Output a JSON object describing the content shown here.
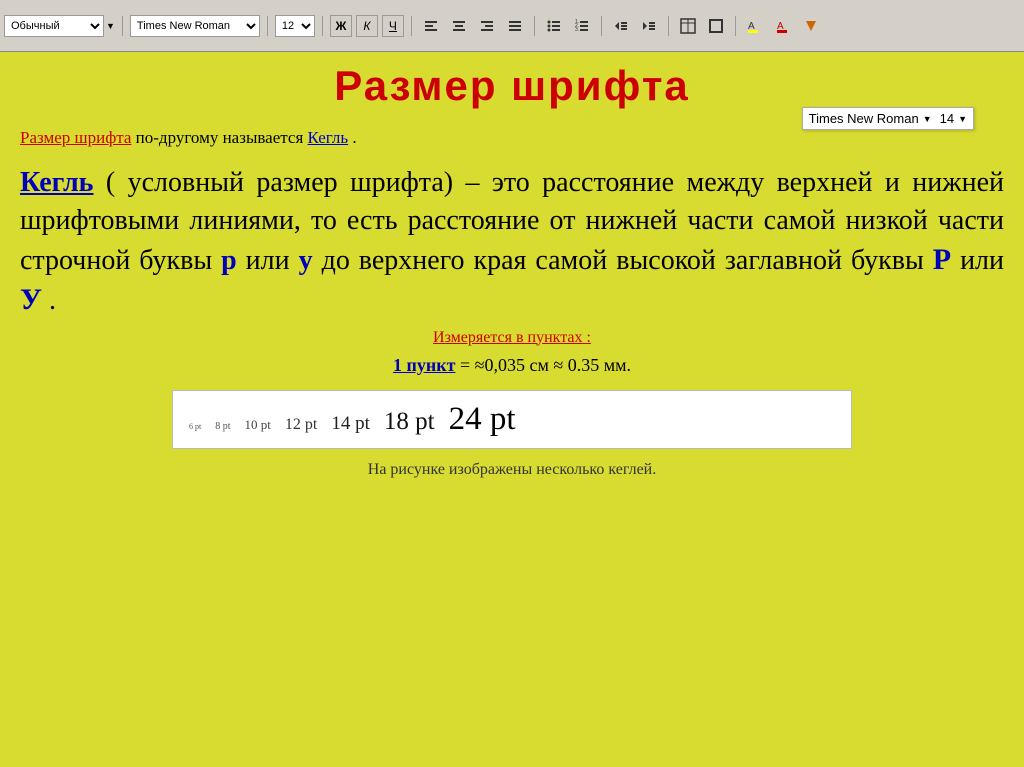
{
  "toolbar": {
    "style_select": "Обычный",
    "font_select": "Times New Roman",
    "size_select": "12",
    "bold_label": "Ж",
    "italic_label": "К",
    "underline_label": "Ч"
  },
  "font_preview": {
    "name": "Times New Roman",
    "size": "14",
    "arrow": "▼"
  },
  "slide": {
    "title": "Размер шрифта",
    "subtitle_part1": "Размер шрифта",
    "subtitle_part2": " по-другому называется ",
    "subtitle_part3": "Кегль",
    "subtitle_part4": ".",
    "def_term": "Кегль",
    "def_rest": " ( условный размер шрифта) – это расстояние между верхней и нижней шрифтовыми линиями, то есть расстояние от нижней части самой низкой части строчной буквы ",
    "def_p": "р",
    "def_or1": " или ",
    "def_y": "у",
    "def_rest2": " до верхнего края самой высокой заглавной буквы ",
    "def_P": "Р",
    "def_or2": " или ",
    "def_Y": "У",
    "def_dot": ".",
    "measure_text": "Измеряется в пунктах",
    "measure_colon": ":",
    "point_def_pre": "1 пункт",
    "point_def_rest": " = ≈0,035 см ≈ 0.35 мм.",
    "demo_sizes": [
      {
        "label": "6 pt",
        "size": 8
      },
      {
        "label": "8 pt",
        "size": 10
      },
      {
        "label": "10 pt",
        "size": 12
      },
      {
        "label": "12 pt",
        "size": 14
      },
      {
        "label": "14 pt",
        "size": 17
      },
      {
        "label": "18 pt",
        "size": 22
      },
      {
        "label": "24 pt",
        "size": 30
      }
    ],
    "caption": "На рисунке изображены несколько кеглей."
  }
}
